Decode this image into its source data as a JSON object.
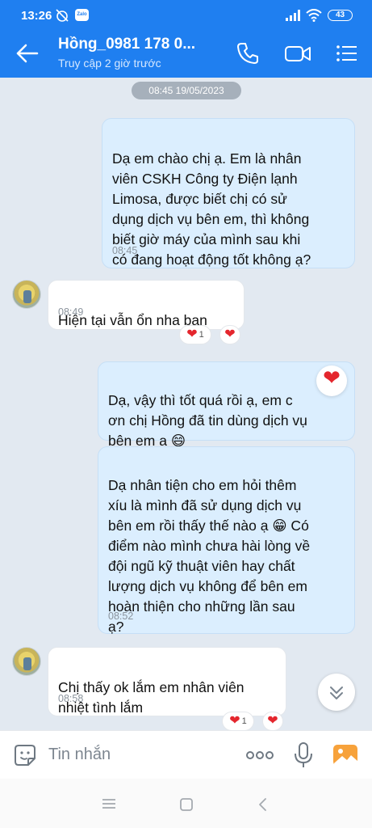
{
  "status_bar": {
    "time": "13:26",
    "zalo_badge": "Zalo",
    "battery": "43"
  },
  "header": {
    "title": "Hồng_0981 178 0...",
    "subtitle": "Truy cập 2 giờ trước",
    "icons": [
      "back-arrow-icon",
      "phone-icon",
      "video-call-icon",
      "menu-icon"
    ]
  },
  "chat": {
    "date_separator": "08:45 19/05/2023",
    "messages": [
      {
        "direction": "out",
        "text": "Dạ em chào chị ạ. Em là nhân\nviên CSKH Công ty Điện lạnh\nLimosa, được biết chị có sử\ndụng dịch vụ bên em, thì không\nbiết giờ máy của mình sau khi\ncó đang hoạt động tốt không ạ?",
        "time": "08:45"
      },
      {
        "direction": "in",
        "text": "Hiện tại vẫn ổn nha bạn",
        "time": "08:49",
        "reaction_count": "1"
      },
      {
        "direction": "out",
        "text": "Dạ, vậy thì tốt quá rồi ạ, em c\nơn chị Hồng đã tin dùng dịch vụ\nbên em ạ 😄",
        "time": ""
      },
      {
        "direction": "out",
        "text": "Dạ nhân tiện cho em hỏi thêm\nxíu là mình đã sử dụng dịch vụ\nbên em rồi thấy thế nào ạ 😁 Có\nđiểm nào mình chưa hài lòng về\nđội ngũ kỹ thuật viên hay chất\nlượng dịch vụ không để bên em\nhoàn thiện cho những lần sau\nạ?",
        "time": "08:52"
      },
      {
        "direction": "in",
        "text": "Chị thấy ok lắm em nhân viên\nnhiệt tình lắm",
        "time": "08:58",
        "reaction_count": "1"
      }
    ],
    "reaction_icon": "heart-icon",
    "heart_glyph": "❤"
  },
  "input_bar": {
    "placeholder": "Tin nhắn",
    "more_label": "ooo"
  },
  "colors": {
    "brand": "#1f7ff0",
    "outgoing_bubble": "#dbeefe",
    "background": "#e2e9f1",
    "heart": "#e4262d"
  }
}
